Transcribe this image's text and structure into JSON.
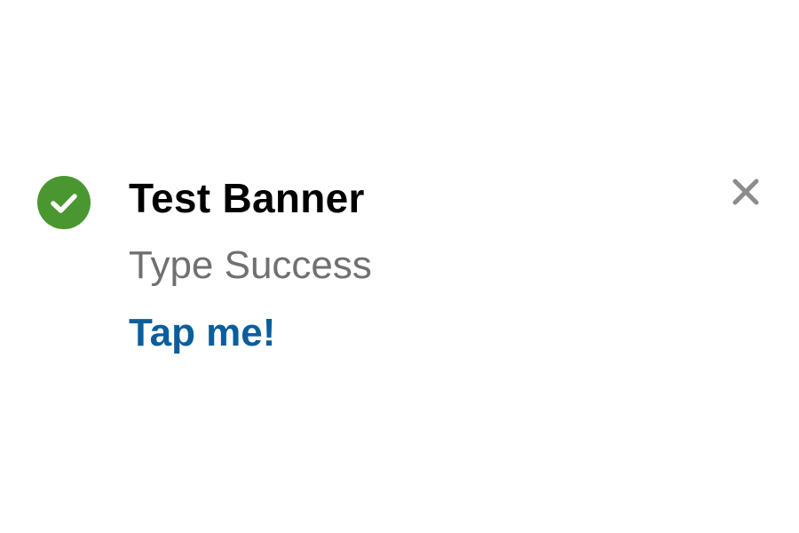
{
  "banner": {
    "type": "success",
    "title": "Test Banner",
    "subtitle": "Type Success",
    "action_label": "Tap me!",
    "icons": {
      "status": "check-circle-icon",
      "close": "close-icon"
    },
    "colors": {
      "success": "#4a9630",
      "title": "#000000",
      "subtitle": "#707070",
      "action": "#0a5e9c",
      "close": "#8c8c8c",
      "background": "#ffffff"
    }
  }
}
